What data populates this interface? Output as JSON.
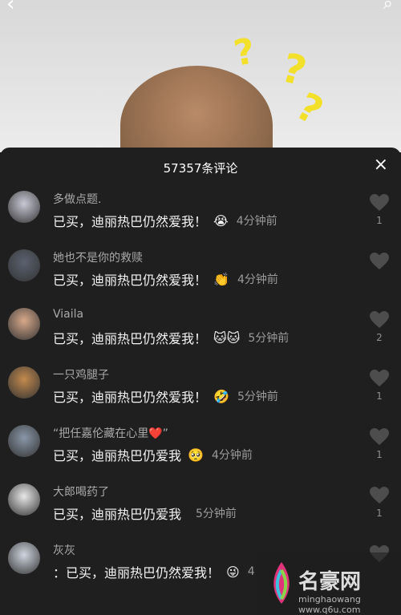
{
  "video": {
    "back_icon": "chevron-left-icon",
    "search_icon": "search-icon",
    "marks": [
      "?",
      "?",
      "?"
    ]
  },
  "comments_panel": {
    "title": "57357条评论",
    "close_label": "×"
  },
  "comments": [
    {
      "username": "多做点题.",
      "text": "已买，迪丽热巴仍然爱我！",
      "emoji": "😭",
      "time": "4分钟前",
      "likes": "1"
    },
    {
      "username": "她也不是你的救赎",
      "text": "已买，迪丽热巴仍然爱我！",
      "emoji": "👏",
      "time": "4分钟前",
      "likes": ""
    },
    {
      "username": "Viaila",
      "text": "已买，迪丽热巴仍然爱我！",
      "emoji": "🐱🐱",
      "time": "5分钟前",
      "likes": "2"
    },
    {
      "username": "一只鸡腿子",
      "text": "已买，迪丽热巴仍然爱我！",
      "emoji": "🤣",
      "time": "5分钟前",
      "likes": "1"
    },
    {
      "username": "“把任嘉伦藏在心里❤️”",
      "text": "已买，迪丽热巴仍爱我",
      "emoji": "🥺",
      "time": "4分钟前",
      "likes": "1"
    },
    {
      "username": "大郎喝药了",
      "text": "已买，迪丽热巴仍爱我",
      "emoji": "",
      "time": "5分钟前",
      "likes": "1"
    },
    {
      "username": "灰灰",
      "text": "：已买，迪丽热巴仍然爱我！",
      "emoji": "😜",
      "time": "4",
      "likes": ""
    }
  ],
  "watermark": {
    "text": "名豪网",
    "sub": "minghaowang www.q6u.com"
  },
  "colors": {
    "panel": "#1f1f1f",
    "username": "#a9a9a9",
    "text": "#f4f4f4",
    "question": "#f3e02a"
  }
}
